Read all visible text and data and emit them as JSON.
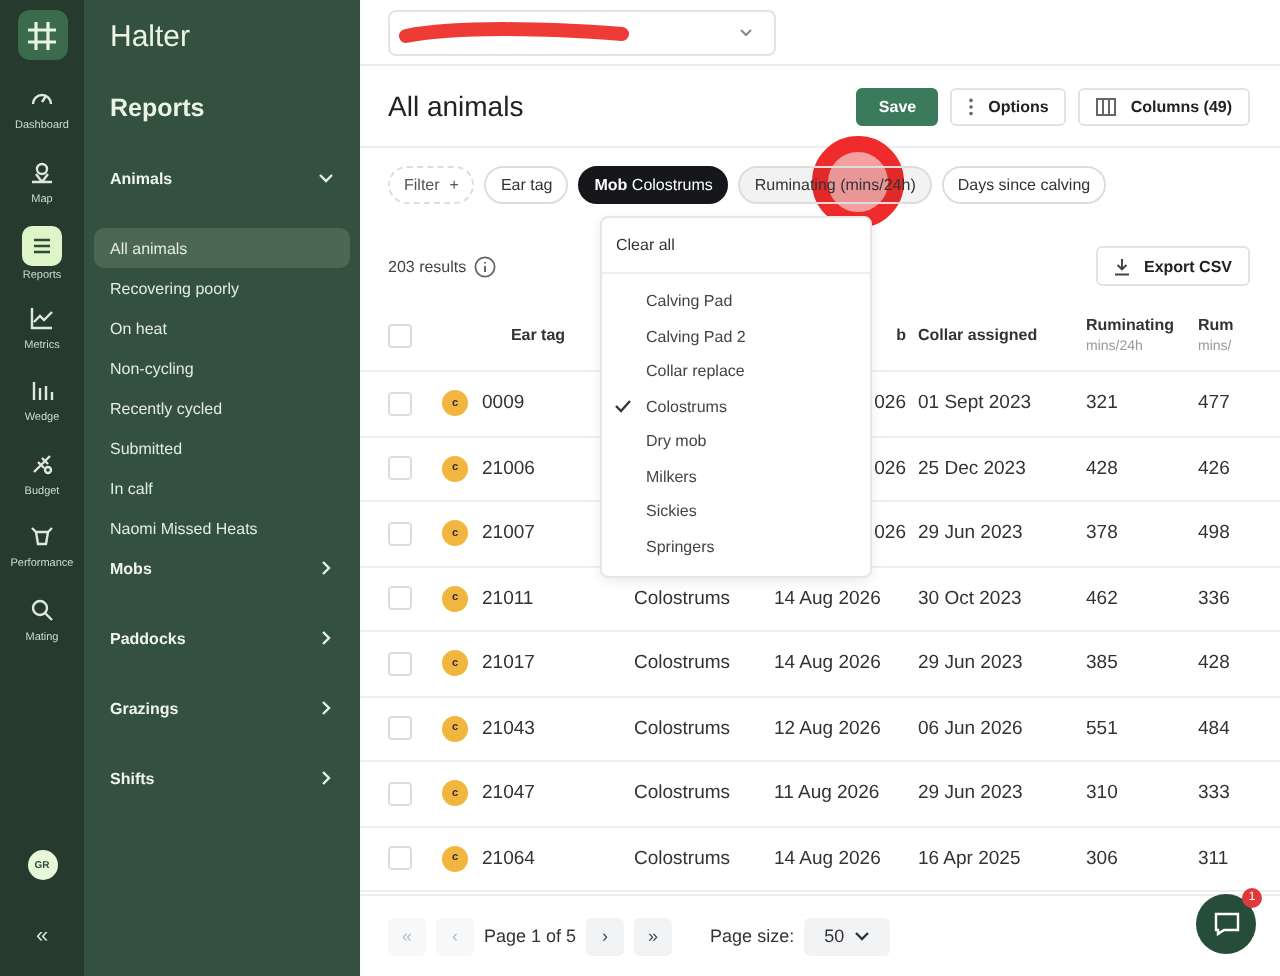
{
  "rail": {
    "items": [
      {
        "label": "Dashboard",
        "selected": false
      },
      {
        "label": "Map",
        "selected": false
      },
      {
        "label": "Reports",
        "selected": true
      },
      {
        "label": "Metrics",
        "selected": false
      },
      {
        "label": "Wedge",
        "selected": false
      },
      {
        "label": "Budget",
        "selected": false
      },
      {
        "label": "Performance",
        "selected": false
      },
      {
        "label": "Mating",
        "selected": false
      }
    ],
    "avatar": "GR",
    "collapse": "«"
  },
  "nav": {
    "brand": "Halter",
    "title": "Reports",
    "sections": [
      {
        "label": "Animals",
        "expanded": true,
        "children": [
          {
            "label": "All animals",
            "selected": true
          },
          {
            "label": "Recovering poorly",
            "selected": false
          },
          {
            "label": "On heat",
            "selected": false
          },
          {
            "label": "Non-cycling",
            "selected": false
          },
          {
            "label": "Recently cycled",
            "selected": false
          },
          {
            "label": "Submitted",
            "selected": false
          },
          {
            "label": "In calf",
            "selected": false
          },
          {
            "label": "Naomi Missed Heats",
            "selected": false
          }
        ]
      },
      {
        "label": "Mobs",
        "expanded": false
      },
      {
        "label": "Paddocks",
        "expanded": false
      },
      {
        "label": "Grazings",
        "expanded": false
      },
      {
        "label": "Shifts",
        "expanded": false
      }
    ]
  },
  "header": {
    "title": "All animals",
    "buttons": [
      {
        "label": "Save",
        "kind": "primary"
      },
      {
        "label": "Options",
        "kind": "options"
      },
      {
        "label": "Columns (49)",
        "kind": "columns"
      }
    ]
  },
  "chips": [
    {
      "label": "Filter",
      "plus": "+",
      "kind": "add",
      "selected": false,
      "pressed": false
    },
    {
      "label": "Ear tag",
      "kind": "filter",
      "selected": false,
      "pressed": false
    },
    {
      "label": "**Mob** Colostrums",
      "kind": "filter",
      "selected": true,
      "pressed": false
    },
    {
      "label": "Ruminating (mins/24h)",
      "kind": "filter",
      "selected": false,
      "pressed": true
    },
    {
      "label": "Days since calving",
      "kind": "filter",
      "selected": false,
      "pressed": false
    }
  ],
  "results": "203 results",
  "export": "Export CSV",
  "table": {
    "select_all_checked": false,
    "columns": [
      {
        "label": "Ear tag"
      },
      {
        "label": "b"
      },
      {
        "label": "Collar assigned"
      },
      {
        "label": "Ruminating",
        "sub": "mins/24h"
      },
      {
        "label": "Rum",
        "sub": "mins/"
      }
    ],
    "rows": [
      {
        "tag": "0009",
        "badge": "c",
        "date": "026",
        "collar": "01 Sept 2023",
        "rum": "321",
        "rum2": "477",
        "checked": false
      },
      {
        "tag": "21006",
        "badge": "c",
        "date": "026",
        "collar": "25 Dec 2023",
        "rum": "428",
        "rum2": "426",
        "checked": false
      },
      {
        "tag": "21007",
        "badge": "c",
        "date": "026",
        "collar": "29 Jun 2023",
        "rum": "378",
        "rum2": "498",
        "checked": false
      },
      {
        "tag": "21011",
        "badge": "c",
        "mob": "Colostrums",
        "date": "14 Aug 2026",
        "collar": "30 Oct 2023",
        "rum": "462",
        "rum2": "336",
        "checked": false
      },
      {
        "tag": "21017",
        "badge": "c",
        "mob": "Colostrums",
        "date": "14 Aug 2026",
        "collar": "29 Jun 2023",
        "rum": "385",
        "rum2": "428",
        "checked": false
      },
      {
        "tag": "21043",
        "badge": "c",
        "mob": "Colostrums",
        "date": "12 Aug 2026",
        "collar": "06 Jun 2026",
        "rum": "551",
        "rum2": "484",
        "checked": false
      },
      {
        "tag": "21047",
        "badge": "c",
        "mob": "Colostrums",
        "date": "11 Aug 2026",
        "collar": "29 Jun 2023",
        "rum": "310",
        "rum2": "333",
        "checked": false
      },
      {
        "tag": "21064",
        "badge": "c",
        "mob": "Colostrums",
        "date": "14 Aug 2026",
        "collar": "16 Apr 2025",
        "rum": "306",
        "rum2": "311",
        "checked": false
      }
    ]
  },
  "dropdown": {
    "clear": "Clear all",
    "options": [
      {
        "label": "Calving Pad",
        "checked": false
      },
      {
        "label": "Calving Pad 2",
        "checked": false
      },
      {
        "label": "Collar replace",
        "checked": false
      },
      {
        "label": "Colostrums",
        "checked": true
      },
      {
        "label": "Dry mob",
        "checked": false
      },
      {
        "label": "Milkers",
        "checked": false
      },
      {
        "label": "Sickies",
        "checked": false
      },
      {
        "label": "Springers",
        "checked": false
      }
    ]
  },
  "pager": {
    "first": "«",
    "prev": "‹",
    "next": "›",
    "last": "»",
    "first_disabled": true,
    "prev_disabled": true,
    "next_disabled": false,
    "last_disabled": false,
    "page": "Page 1 of 5",
    "size_label": "Page size:",
    "size": "50"
  },
  "chat": {
    "badge": "1"
  }
}
